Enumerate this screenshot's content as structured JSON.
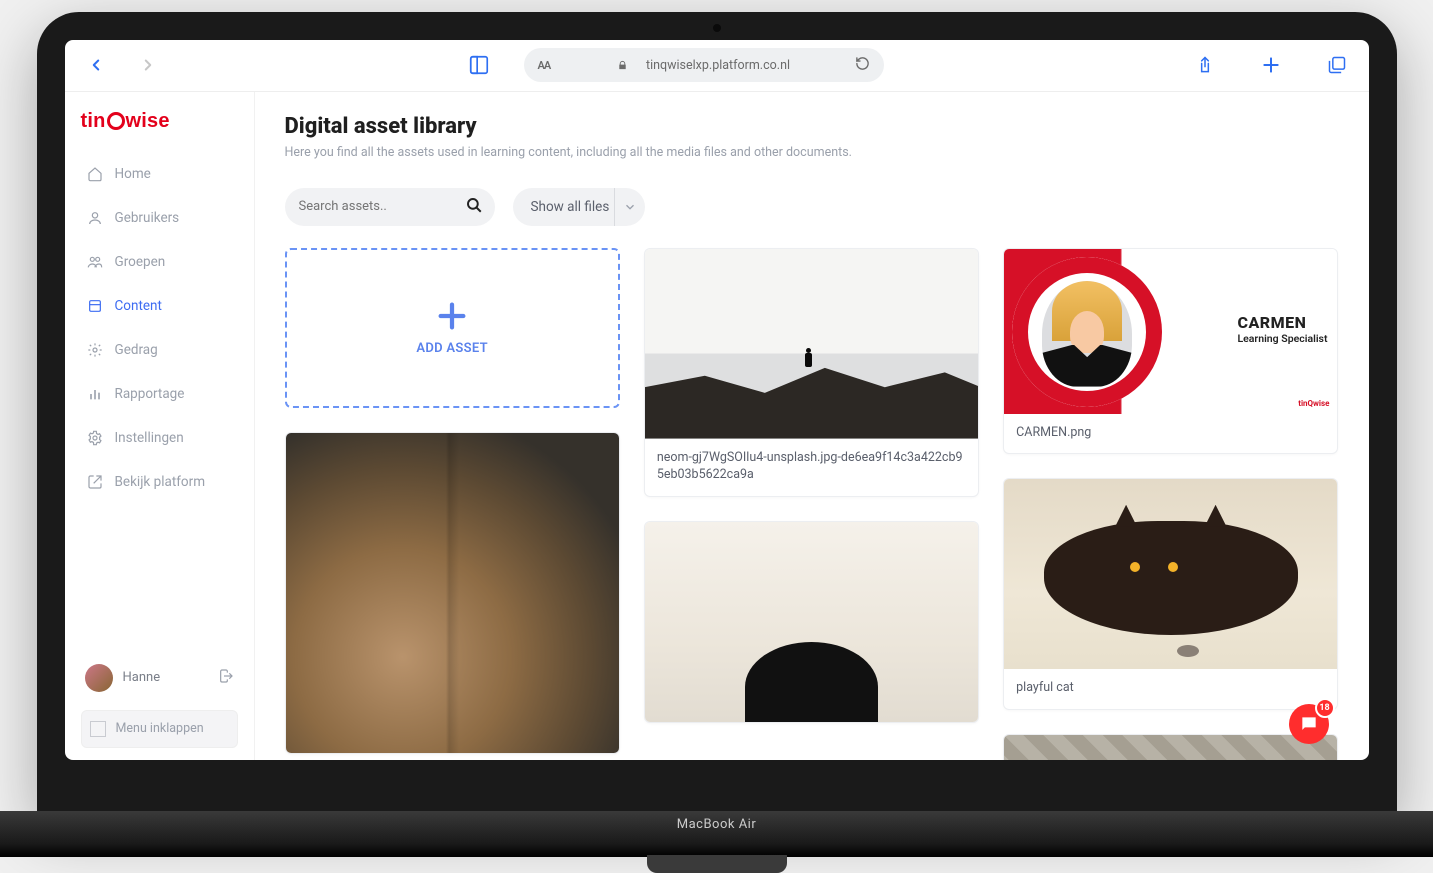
{
  "browser": {
    "url": "tinqwiselxp.platform.co.nl",
    "reader_text": "AA"
  },
  "brand": "tinQwise",
  "sidebar": {
    "items": [
      {
        "label": "Home",
        "icon": "home-icon"
      },
      {
        "label": "Gebruikers",
        "icon": "user-icon"
      },
      {
        "label": "Groepen",
        "icon": "groups-icon"
      },
      {
        "label": "Content",
        "icon": "content-icon"
      },
      {
        "label": "Gedrag",
        "icon": "gear-icon"
      },
      {
        "label": "Rapportage",
        "icon": "bars-icon"
      },
      {
        "label": "Instellingen",
        "icon": "cog-icon"
      },
      {
        "label": "Bekijk platform",
        "icon": "external-icon"
      }
    ],
    "active_index": 3,
    "user": {
      "name": "Hanne"
    },
    "collapse_label": "Menu inklappen"
  },
  "page": {
    "title": "Digital asset library",
    "subtitle": "Here you find all the assets used in learning content, including all the media files and other documents.",
    "search_placeholder": "Search assets..",
    "filter_label": "Show all files",
    "add_label": "ADD ASSET"
  },
  "assets": [
    {
      "caption": "neom-gj7WgSOIlu4-unsplash.jpg-de6ea9f14c3a422cb95eb03b5622ca9a"
    },
    {
      "caption": "CARMEN.png"
    },
    {
      "caption": "playful cat"
    }
  ],
  "carmen": {
    "name": "CARMEN",
    "role_line1": "Learning",
    "role_line2": "Specialist"
  },
  "chat_badge": "18"
}
